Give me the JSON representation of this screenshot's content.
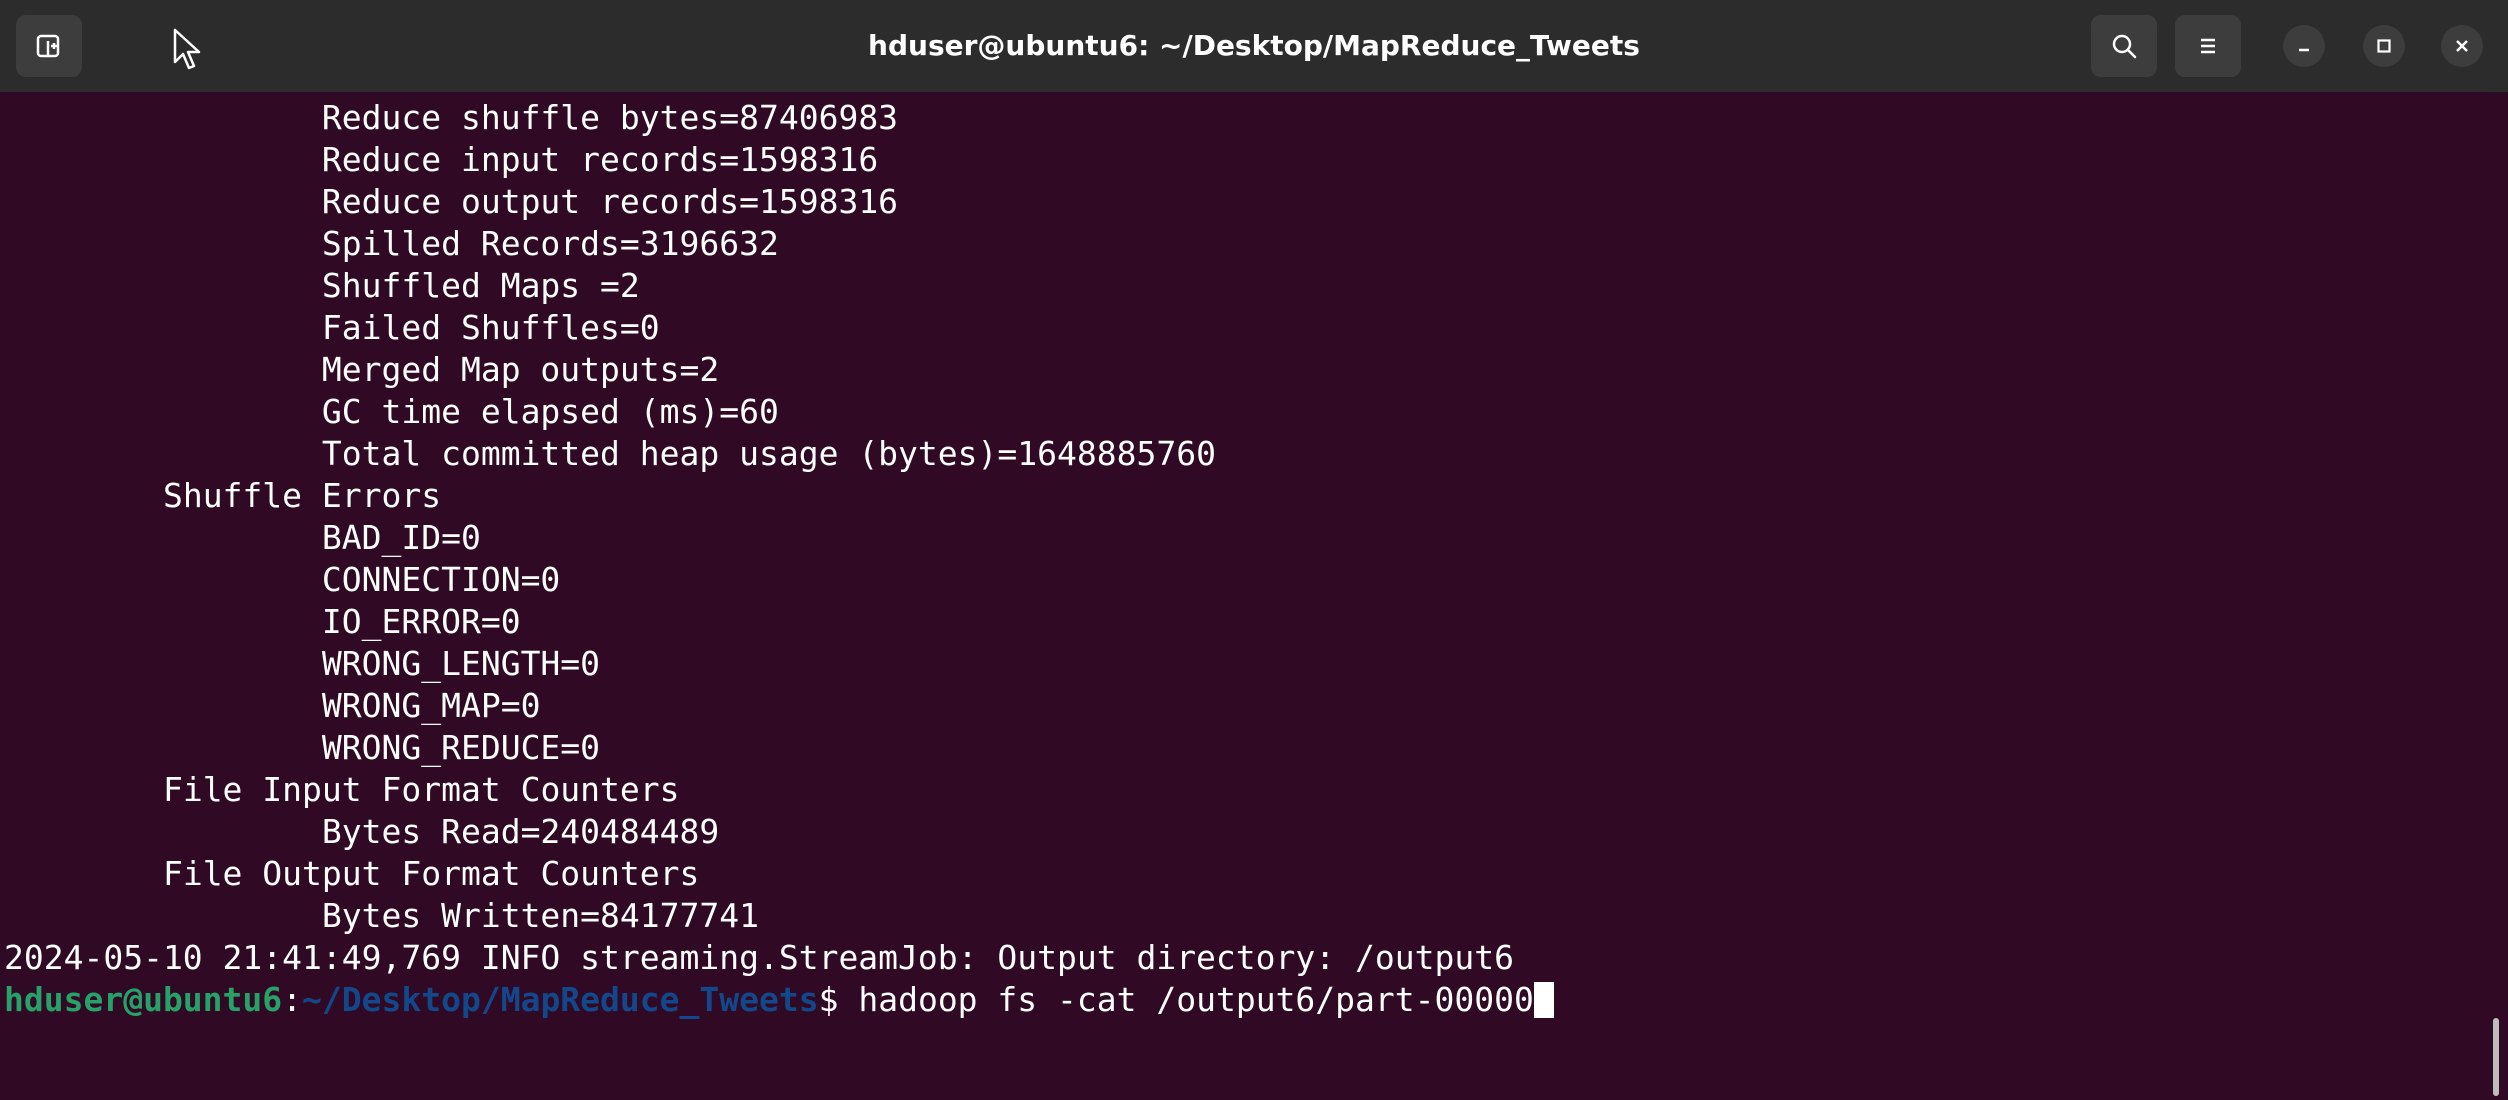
{
  "window": {
    "title": "hduser@ubuntu6: ~/Desktop/MapReduce_Tweets"
  },
  "titlebar": {
    "new_tab_icon": "new-tab-icon",
    "search_icon": "search-icon",
    "menu_icon": "hamburger-menu-icon",
    "minimize_icon": "minimize-icon",
    "maximize_icon": "maximize-icon",
    "close_icon": "close-icon"
  },
  "colors": {
    "terminal_bg": "#300a24",
    "titlebar_bg": "#2c2c2c",
    "prompt_user": "#26a269",
    "prompt_path": "#12488b",
    "text": "#ffffff"
  },
  "terminal": {
    "lines": [
      "\t\tReduce shuffle bytes=87406983",
      "\t\tReduce input records=1598316",
      "\t\tReduce output records=1598316",
      "\t\tSpilled Records=3196632",
      "\t\tShuffled Maps =2",
      "\t\tFailed Shuffles=0",
      "\t\tMerged Map outputs=2",
      "\t\tGC time elapsed (ms)=60",
      "\t\tTotal committed heap usage (bytes)=1648885760",
      "\tShuffle Errors",
      "\t\tBAD_ID=0",
      "\t\tCONNECTION=0",
      "\t\tIO_ERROR=0",
      "\t\tWRONG_LENGTH=0",
      "\t\tWRONG_MAP=0",
      "\t\tWRONG_REDUCE=0",
      "\tFile Input Format Counters",
      "\t\tBytes Read=240484489",
      "\tFile Output Format Counters",
      "\t\tBytes Written=84177741",
      "2024-05-10 21:41:49,769 INFO streaming.StreamJob: Output directory: /output6"
    ],
    "prompt": {
      "user_host": "hduser@ubuntu6",
      "colon": ":",
      "path": "~/Desktop/MapReduce_Tweets",
      "symbol": "$ ",
      "command": "hadoop fs -cat /output6/part-00000"
    }
  }
}
